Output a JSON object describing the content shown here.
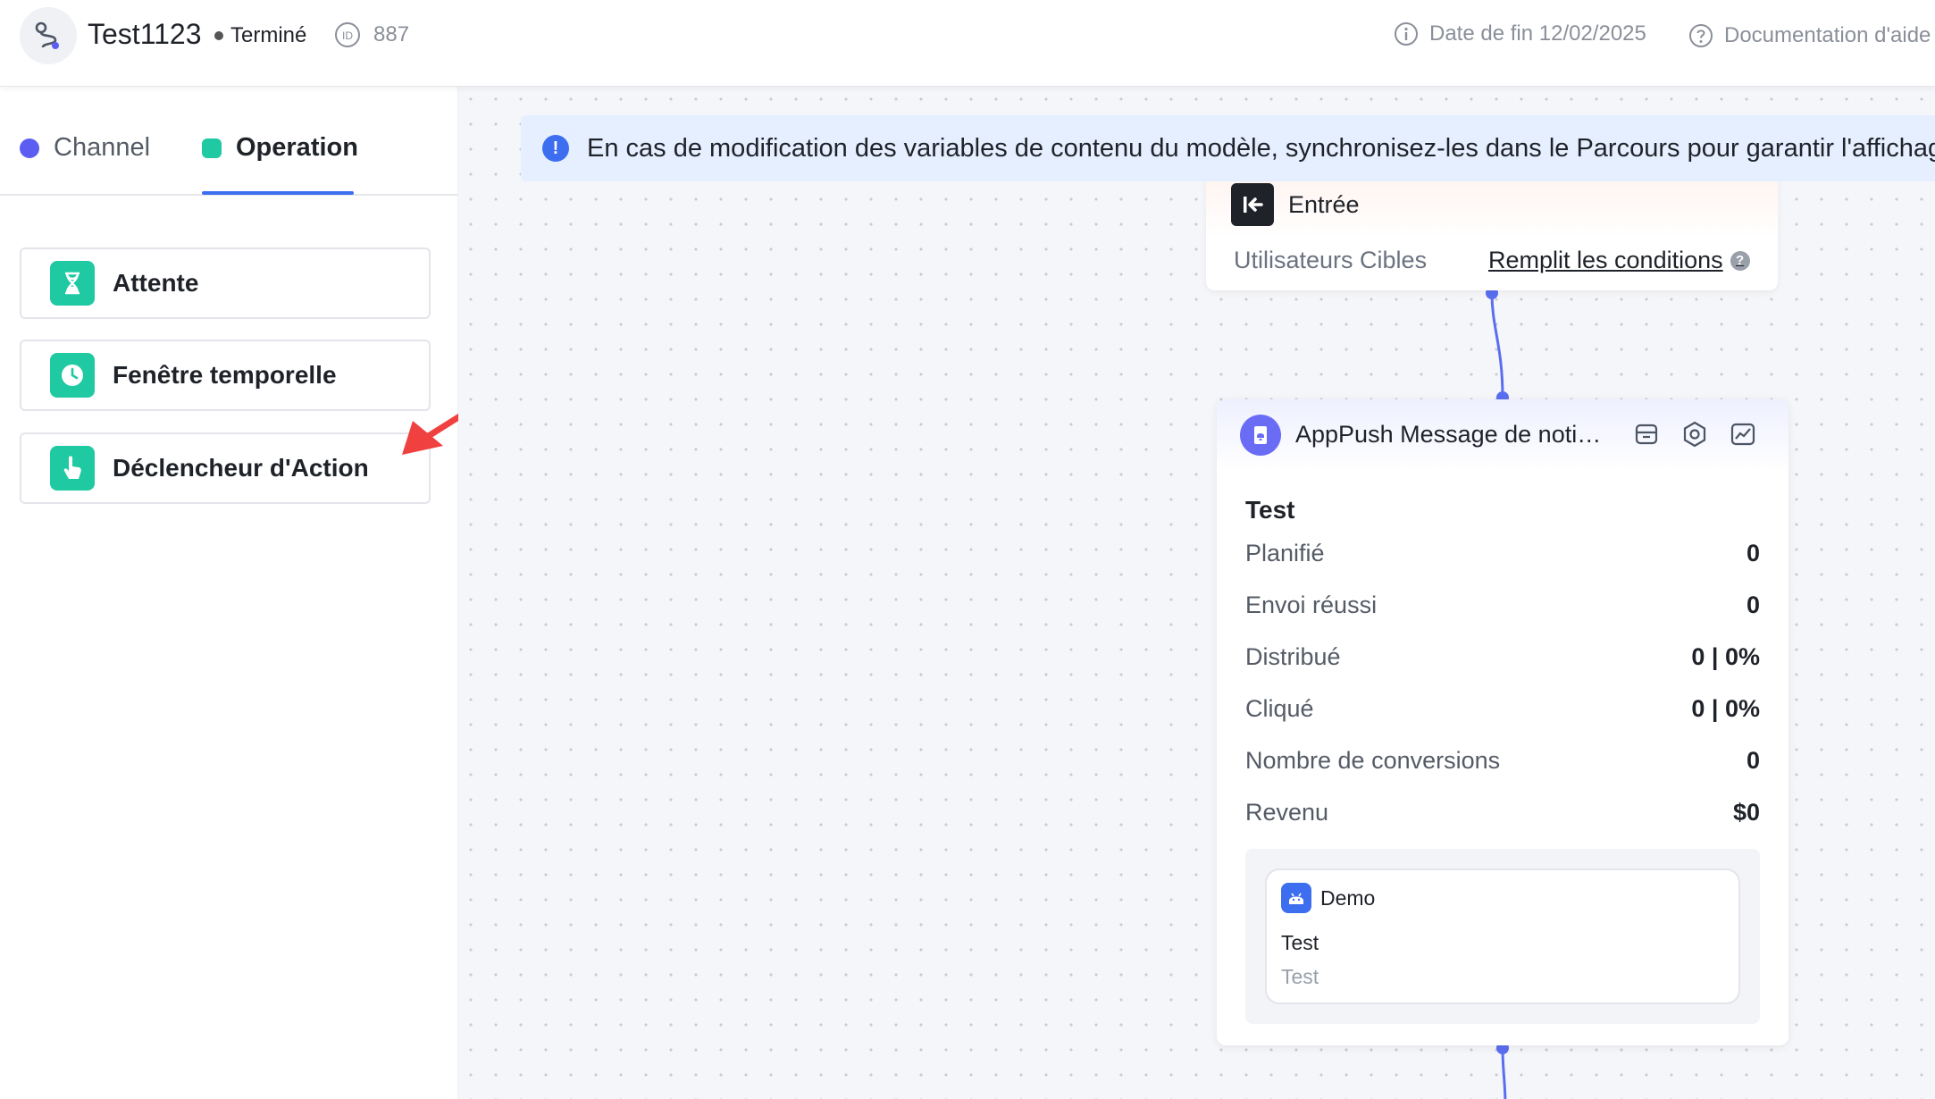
{
  "header": {
    "title": "Test1123",
    "status": "Terminé",
    "id_label": "ID",
    "id_value": "887",
    "end_date": "Date de fin 12/02/2025",
    "help": "Documentation d'aide"
  },
  "sidebar": {
    "tabs": [
      {
        "label": "Channel",
        "color": "#5b5ef0",
        "active": false
      },
      {
        "label": "Operation",
        "color": "#1fc9a2",
        "active": true
      }
    ],
    "operations": [
      {
        "label": "Attente",
        "icon": "hourglass-icon"
      },
      {
        "label": "Fenêtre temporelle",
        "icon": "clock-icon"
      },
      {
        "label": "Déclencheur d'Action",
        "icon": "hand-pointer-icon"
      }
    ]
  },
  "canvas": {
    "banner": "En cas de modification des variables de contenu du modèle, synchronisez-les dans le Parcours pour garantir l'affichage de",
    "entry": {
      "title": "Entrée",
      "target_label": "Utilisateurs Cibles",
      "condition_link": "Remplit les conditions"
    },
    "message_node": {
      "title": "AppPush Message de noti…",
      "name": "Test",
      "stats": [
        {
          "label": "Planifié",
          "value": "0"
        },
        {
          "label": "Envoi réussi",
          "value": "0"
        },
        {
          "label": "Distribué",
          "value": "0 | 0%"
        },
        {
          "label": "Cliqué",
          "value": "0 | 0%"
        },
        {
          "label": "Nombre de conversions",
          "value": "0"
        },
        {
          "label": "Revenu",
          "value": "$0"
        }
      ],
      "preview": {
        "app_name": "Demo",
        "title": "Test",
        "body": "Test"
      }
    }
  },
  "colors": {
    "accent": "#3d6ef0",
    "operation_green": "#1fc9a2",
    "channel_purple": "#5b5ef0",
    "annotation_red": "#f04040"
  }
}
